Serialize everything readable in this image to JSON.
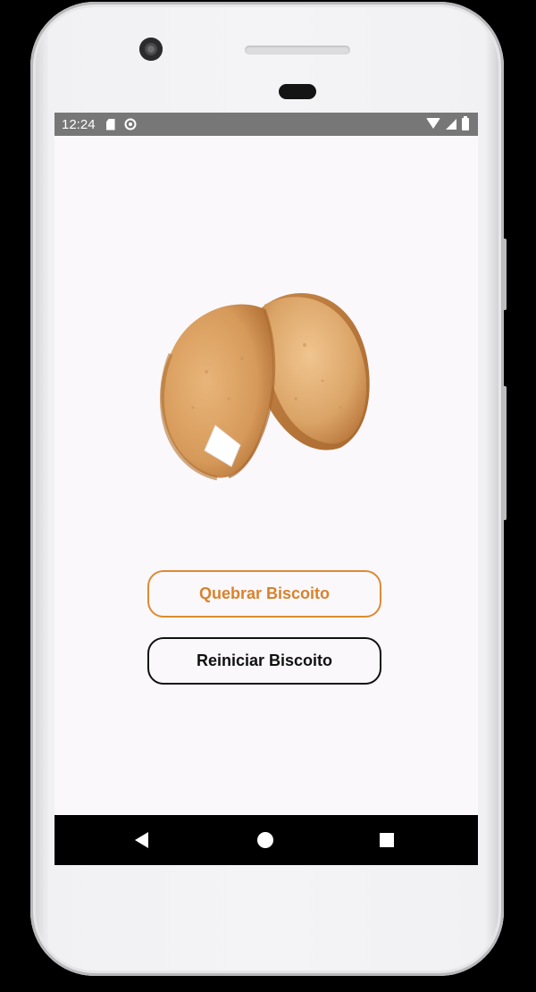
{
  "status_bar": {
    "time": "12:24",
    "left_icons": [
      "sd-card-icon",
      "sync-icon"
    ],
    "right_icons": [
      "wifi-icon",
      "signal-icon",
      "battery-icon"
    ]
  },
  "main": {
    "image": "fortune-cookie",
    "buttons": {
      "break_label": "Quebrar Biscoito",
      "reset_label": "Reiniciar Biscoito"
    }
  },
  "colors": {
    "accent": "#DD8A33",
    "screen_background": "#FAF8FB",
    "status_bar": "#777777",
    "navigation_bar": "#000000"
  },
  "navigation_bar": {
    "icons": [
      "back-icon",
      "home-icon",
      "recents-icon"
    ]
  }
}
